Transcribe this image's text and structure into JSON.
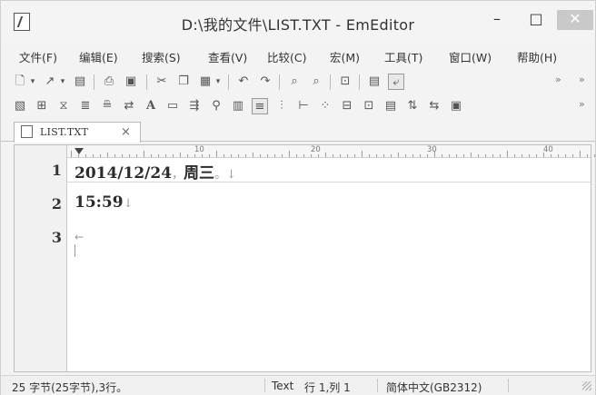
{
  "window": {
    "title": "D:\\我的文件\\LIST.TXT - EmEditor",
    "minimize_glyph": "–",
    "maximize_glyph": "□",
    "close_glyph": "✕"
  },
  "menu": {
    "items": [
      "文件(F)",
      "编辑(E)",
      "搜索(S)",
      "查看(V)",
      "比较(C)",
      "宏(M)",
      "工具(T)",
      "窗口(W)",
      "帮助(H)"
    ]
  },
  "toolbar": {
    "overflow_glyph": "»",
    "icons1": [
      "new-file-icon",
      "dropdown-arrow-icon",
      "open-file-icon",
      "dropdown-arrow-icon",
      "save-icon",
      "print-icon",
      "print-preview-icon",
      "cut-icon",
      "copy-icon",
      "paste-icon",
      "dropdown-arrow-icon",
      "undo-icon",
      "redo-icon",
      "find-icon",
      "find-next-icon",
      "find-in-files-icon",
      "wrap-icon",
      "word-wrap-toggle-icon"
    ],
    "icons2": [
      "markers-icon",
      "columns-icon",
      "sort-icon",
      "format-icon",
      "outline-icon",
      "convert-icon",
      "font-icon",
      "window-icon",
      "compare-icon",
      "bookmark-icon",
      "statistics-icon",
      "mark-all-icon",
      "vertical-icon",
      "split-icon",
      "split-horizontal-icon",
      "layout-icon",
      "tile-icon",
      "sync-icon",
      "swap-icon",
      "list-icon"
    ]
  },
  "tab": {
    "label": "LIST.TXT",
    "close_glyph": "×"
  },
  "ruler": {
    "labels": [
      "10",
      "20",
      "30",
      "40"
    ]
  },
  "editor": {
    "lines": [
      {
        "number": "1",
        "text": "2014/12/24",
        "text2": "周三",
        "marks": [
          "，",
          "。",
          "↓"
        ]
      },
      {
        "number": "2",
        "text": "15:59",
        "marks": [
          "↓"
        ]
      },
      {
        "number": "3",
        "text": "",
        "marks": [
          "←"
        ]
      }
    ]
  },
  "status": {
    "size": "25 字节(25字节),3行。",
    "mode": "Text",
    "position": "行 1,列 1",
    "encoding": "简体中文(GB2312)"
  }
}
